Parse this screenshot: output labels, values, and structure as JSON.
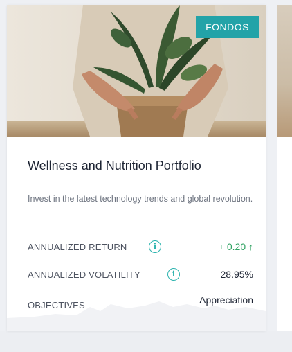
{
  "card": {
    "badge": "FONDOS",
    "title": "Wellness and Nutrition Portfolio",
    "description": "Invest in the latest technology trends and global revolution.",
    "metrics": [
      {
        "label": "ANNUALIZED RETURN",
        "value": "+ 0.20 ↑",
        "info_icon": "info-icon"
      },
      {
        "label": "ANNUALIZED VOLATILITY",
        "value": "28.95%",
        "info_icon": "info-icon"
      },
      {
        "label": "OBJECTIVES",
        "value": "Appreciation"
      }
    ]
  },
  "colors": {
    "badge": "#23a3a8",
    "positive": "#2da160",
    "info_icon": "#2bb3ae",
    "title": "#1d2433"
  },
  "image": {
    "semantic": "hands-potting-plant-photo"
  }
}
